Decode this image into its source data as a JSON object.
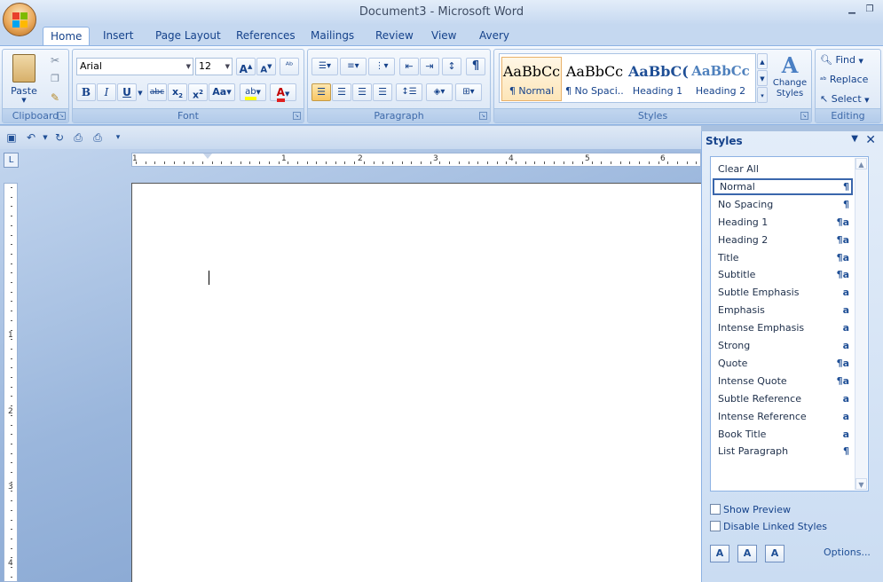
{
  "window": {
    "title": "Document3 - Microsoft Word"
  },
  "tabs": [
    {
      "label": "Home",
      "active": true
    },
    {
      "label": "Insert"
    },
    {
      "label": "Page Layout"
    },
    {
      "label": "References"
    },
    {
      "label": "Mailings"
    },
    {
      "label": "Review"
    },
    {
      "label": "View"
    },
    {
      "label": "Avery"
    }
  ],
  "ribbon": {
    "clipboard": {
      "label": "Clipboard",
      "paste": "Paste"
    },
    "font": {
      "label": "Font",
      "name": "Arial",
      "size": "12"
    },
    "paragraph": {
      "label": "Paragraph"
    },
    "styles": {
      "label": "Styles",
      "gallery": [
        {
          "sample": "AaBbCc",
          "name": "¶ Normal"
        },
        {
          "sample": "AaBbCc",
          "name": "¶ No Spaci..."
        },
        {
          "sample": "AaBbC(",
          "name": "Heading 1"
        },
        {
          "sample": "AaBbCc",
          "name": "Heading 2"
        }
      ],
      "change_styles": "Change Styles"
    },
    "editing": {
      "label": "Editing",
      "find": "Find",
      "replace": "Replace",
      "select": "Select"
    }
  },
  "ruler": {
    "h_numbers": [
      "1",
      "1",
      "2",
      "3",
      "4",
      "5",
      "6"
    ],
    "v_numbers": [
      "1",
      "2",
      "3",
      "4"
    ]
  },
  "styles_pane": {
    "title": "Styles",
    "items": [
      {
        "label": "Clear All",
        "mark": ""
      },
      {
        "label": "Normal",
        "mark": "¶"
      },
      {
        "label": "No Spacing",
        "mark": "¶"
      },
      {
        "label": "Heading 1",
        "mark": "¶a"
      },
      {
        "label": "Heading 2",
        "mark": "¶a"
      },
      {
        "label": "Title",
        "mark": "¶a"
      },
      {
        "label": "Subtitle",
        "mark": "¶a"
      },
      {
        "label": "Subtle Emphasis",
        "mark": "a"
      },
      {
        "label": "Emphasis",
        "mark": "a"
      },
      {
        "label": "Intense Emphasis",
        "mark": "a"
      },
      {
        "label": "Strong",
        "mark": "a"
      },
      {
        "label": "Quote",
        "mark": "¶a"
      },
      {
        "label": "Intense Quote",
        "mark": "¶a"
      },
      {
        "label": "Subtle Reference",
        "mark": "a"
      },
      {
        "label": "Intense Reference",
        "mark": "a"
      },
      {
        "label": "Book Title",
        "mark": "a"
      },
      {
        "label": "List Paragraph",
        "mark": "¶"
      }
    ],
    "show_preview": "Show Preview",
    "disable_linked": "Disable Linked Styles",
    "options": "Options..."
  }
}
